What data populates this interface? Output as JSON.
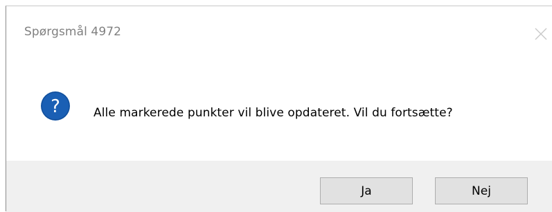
{
  "dialog": {
    "title": "Spørgsmål 4972",
    "message": "Alle markerede punkter vil blive opdateret. Vil du fortsætte?",
    "icon": "question-icon",
    "buttons": {
      "yes_label": "Ja",
      "no_label": "Nej"
    }
  },
  "colors": {
    "icon_blue": "#1a5fb4",
    "footer_bg": "#f0f0f0",
    "button_bg": "#e1e1e1",
    "title_text": "#808080"
  }
}
